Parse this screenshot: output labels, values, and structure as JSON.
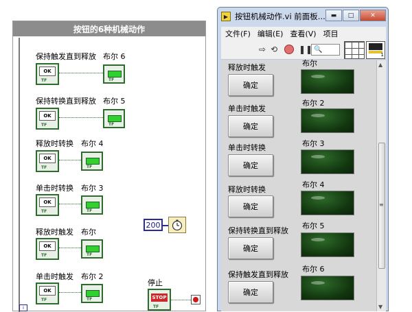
{
  "block_diagram": {
    "title": "按钮的6种机械动作",
    "pairs": [
      {
        "button_label": "保持触发直到释放",
        "indicator_label": "布尔 6"
      },
      {
        "button_label": "保持转换直到释放",
        "indicator_label": "布尔 5"
      },
      {
        "button_label": "释放时转换",
        "indicator_label": "布尔 4"
      },
      {
        "button_label": "单击时转换",
        "indicator_label": "布尔 3"
      },
      {
        "button_label": "释放时触发",
        "indicator_label": "布尔"
      },
      {
        "button_label": "单击时触发",
        "indicator_label": "布尔 2"
      }
    ],
    "terminal_face_text": "OK",
    "terminal_type_text": "TF",
    "wait_constant": "200",
    "stop_label": "停止",
    "stop_face_text": "STOP",
    "iteration_label": "i"
  },
  "front_panel": {
    "window_title": "按钮机械动作.vi 前面板...",
    "window_buttons": {
      "minimize": "▬",
      "maximize": "□",
      "close": "✕"
    },
    "menu": [
      "文件(F)",
      "编辑(E)",
      "查看(V)",
      "项目"
    ],
    "toolbar": {
      "run": "⇨",
      "run_continuous": "⟲",
      "pause": "❚❚",
      "zoom": "🔍"
    },
    "connector_number": "1",
    "rows": [
      {
        "button_label": "释放时触发",
        "button_text": "确定",
        "indicator_label": "布尔"
      },
      {
        "button_label": "单击时触发",
        "button_text": "确定",
        "indicator_label": "布尔 2"
      },
      {
        "button_label": "单击时转换",
        "button_text": "确定",
        "indicator_label": "布尔 3"
      },
      {
        "button_label": "释放时转换",
        "button_text": "确定",
        "indicator_label": "布尔 4"
      },
      {
        "button_label": "保持转换直到释放",
        "button_text": "确定",
        "indicator_label": "布尔 5"
      },
      {
        "button_label": "保持触发直到释放",
        "button_text": "确定",
        "indicator_label": "布尔 6"
      }
    ],
    "scroll": {
      "up": "▲",
      "down": "▼",
      "grip": "≡"
    }
  },
  "colors": {
    "led_on": "#2fd02f",
    "led_off": "#12360f",
    "terminal_border": "#2d6b2d",
    "stop_red": "#cc2a2a"
  }
}
